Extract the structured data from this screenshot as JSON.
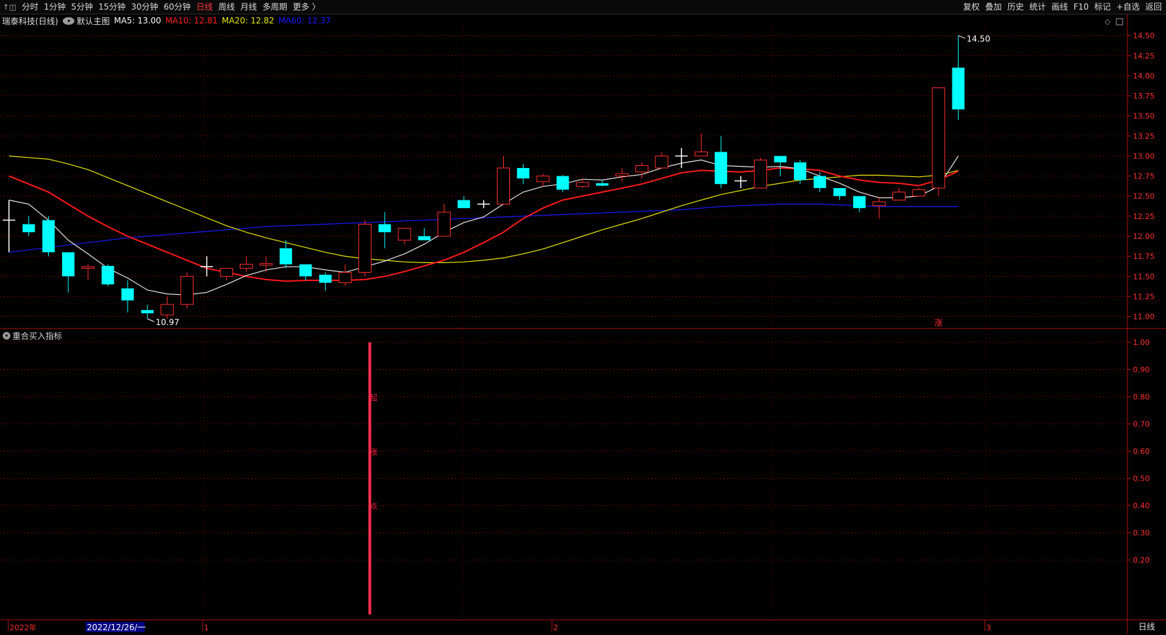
{
  "toolbar": {
    "left_glyph": "↑◫",
    "periods": [
      "分时",
      "1分钟",
      "5分钟",
      "15分钟",
      "30分钟",
      "60分钟",
      "日线",
      "周线",
      "月线",
      "多周期",
      "更多 〉"
    ],
    "active_period": "日线",
    "actions": [
      "复权",
      "叠加",
      "历史",
      "统计",
      "画线",
      "F10",
      "标记",
      "+自选",
      "返回"
    ]
  },
  "main_chart": {
    "stock_name": "瑞泰科技",
    "period_tag": "(日线)",
    "template": "默认主图",
    "ma5": {
      "label": "MA5: 13.00",
      "color": "#ffffff"
    },
    "ma10": {
      "label": "MA10: 12.81",
      "color": "#ff2020"
    },
    "ma20": {
      "label": "MA20: 12.82",
      "color": "#e8e800"
    },
    "ma60": {
      "label": "MA60: 12.37",
      "color": "#1a1aff"
    },
    "high_marker": "14.50",
    "low_marker": "10.97",
    "badge": "涨",
    "up_color": "#ff3030",
    "down_color": "#00ffff"
  },
  "indicator": {
    "title": "重合买入指标",
    "signal_text": [
      "起",
      "涨",
      "点"
    ],
    "signal_color": "#ff3050"
  },
  "x_axis": {
    "labels": [
      "2022年",
      "2022/12/26/一",
      "1",
      "2",
      "3"
    ],
    "mode": "日线"
  },
  "chart_data": [
    {
      "type": "candlestick",
      "title": "瑞泰科技 (日线)",
      "y_ticks": [
        "14.50",
        "14.25",
        "14.00",
        "13.75",
        "13.50",
        "13.25",
        "13.00",
        "12.75",
        "12.50",
        "12.25",
        "12.00",
        "11.75",
        "11.50",
        "11.25",
        "11.00"
      ],
      "ylim": [
        10.85,
        14.6
      ],
      "candles": [
        {
          "o": 12.2,
          "h": 12.45,
          "l": 11.8,
          "c": 12.2
        },
        {
          "o": 12.15,
          "h": 12.25,
          "l": 12.0,
          "c": 12.05
        },
        {
          "o": 12.2,
          "h": 12.25,
          "l": 11.75,
          "c": 11.8
        },
        {
          "o": 11.8,
          "h": 11.8,
          "l": 11.3,
          "c": 11.5
        },
        {
          "o": 11.6,
          "h": 11.65,
          "l": 11.45,
          "c": 11.62
        },
        {
          "o": 11.63,
          "h": 11.65,
          "l": 11.38,
          "c": 11.4
        },
        {
          "o": 11.35,
          "h": 11.45,
          "l": 11.05,
          "c": 11.2
        },
        {
          "o": 11.08,
          "h": 11.15,
          "l": 10.97,
          "c": 11.04
        },
        {
          "o": 11.02,
          "h": 11.25,
          "l": 10.97,
          "c": 11.15
        },
        {
          "o": 11.15,
          "h": 11.55,
          "l": 11.1,
          "c": 11.5
        },
        {
          "o": 11.62,
          "h": 11.75,
          "l": 11.5,
          "c": 11.62
        },
        {
          "o": 11.5,
          "h": 11.6,
          "l": 11.45,
          "c": 11.6
        },
        {
          "o": 11.6,
          "h": 11.75,
          "l": 11.55,
          "c": 11.65
        },
        {
          "o": 11.64,
          "h": 11.75,
          "l": 11.55,
          "c": 11.66
        },
        {
          "o": 11.85,
          "h": 11.95,
          "l": 11.6,
          "c": 11.65
        },
        {
          "o": 11.65,
          "h": 11.65,
          "l": 11.45,
          "c": 11.5
        },
        {
          "o": 11.52,
          "h": 11.55,
          "l": 11.32,
          "c": 11.42
        },
        {
          "o": 11.42,
          "h": 11.65,
          "l": 11.38,
          "c": 11.55
        },
        {
          "o": 11.55,
          "h": 12.2,
          "l": 11.5,
          "c": 12.15
        },
        {
          "o": 12.15,
          "h": 12.3,
          "l": 11.85,
          "c": 12.05
        },
        {
          "o": 11.95,
          "h": 12.1,
          "l": 11.9,
          "c": 12.1
        },
        {
          "o": 12.0,
          "h": 12.1,
          "l": 11.95,
          "c": 11.95
        },
        {
          "o": 12.0,
          "h": 12.4,
          "l": 12.0,
          "c": 12.3
        },
        {
          "o": 12.45,
          "h": 12.5,
          "l": 12.35,
          "c": 12.35
        },
        {
          "o": 12.4,
          "h": 12.45,
          "l": 12.35,
          "c": 12.4
        },
        {
          "o": 12.4,
          "h": 13.0,
          "l": 12.4,
          "c": 12.85
        },
        {
          "o": 12.85,
          "h": 12.9,
          "l": 12.65,
          "c": 12.72
        },
        {
          "o": 12.68,
          "h": 12.78,
          "l": 12.62,
          "c": 12.75
        },
        {
          "o": 12.75,
          "h": 12.76,
          "l": 12.55,
          "c": 12.58
        },
        {
          "o": 12.62,
          "h": 12.72,
          "l": 12.6,
          "c": 12.67
        },
        {
          "o": 12.66,
          "h": 12.7,
          "l": 12.62,
          "c": 12.63
        },
        {
          "o": 12.75,
          "h": 12.85,
          "l": 12.68,
          "c": 12.78
        },
        {
          "o": 12.8,
          "h": 12.92,
          "l": 12.72,
          "c": 12.88
        },
        {
          "o": 12.85,
          "h": 13.05,
          "l": 12.85,
          "c": 13.0
        },
        {
          "o": 13.0,
          "h": 13.1,
          "l": 12.85,
          "c": 13.0
        },
        {
          "o": 13.0,
          "h": 13.28,
          "l": 13.0,
          "c": 13.05
        },
        {
          "o": 13.05,
          "h": 13.25,
          "l": 12.6,
          "c": 12.65
        },
        {
          "o": 12.7,
          "h": 12.75,
          "l": 12.6,
          "c": 12.69
        },
        {
          "o": 12.6,
          "h": 12.98,
          "l": 12.6,
          "c": 12.95
        },
        {
          "o": 13.0,
          "h": 13.0,
          "l": 12.75,
          "c": 12.92
        },
        {
          "o": 12.92,
          "h": 12.95,
          "l": 12.65,
          "c": 12.7
        },
        {
          "o": 12.75,
          "h": 12.8,
          "l": 12.55,
          "c": 12.6
        },
        {
          "o": 12.6,
          "h": 12.6,
          "l": 12.45,
          "c": 12.5
        },
        {
          "o": 12.5,
          "h": 12.5,
          "l": 12.3,
          "c": 12.35
        },
        {
          "o": 12.38,
          "h": 12.48,
          "l": 12.22,
          "c": 12.43
        },
        {
          "o": 12.45,
          "h": 12.6,
          "l": 12.45,
          "c": 12.55
        },
        {
          "o": 12.5,
          "h": 12.6,
          "l": 12.5,
          "c": 12.58
        },
        {
          "o": 12.6,
          "h": 13.85,
          "l": 12.5,
          "c": 13.85
        },
        {
          "o": 14.1,
          "h": 14.5,
          "l": 13.45,
          "c": 13.58
        }
      ],
      "ma5": [
        12.45,
        12.4,
        12.2,
        11.95,
        11.78,
        11.6,
        11.48,
        11.33,
        11.28,
        11.27,
        11.3,
        11.4,
        11.51,
        11.58,
        11.62,
        11.62,
        11.58,
        11.55,
        11.62,
        11.69,
        11.78,
        11.9,
        12.05,
        12.17,
        12.24,
        12.4,
        12.55,
        12.62,
        12.65,
        12.71,
        12.7,
        12.74,
        12.77,
        12.85,
        12.91,
        12.95,
        12.88,
        12.87,
        12.86,
        12.87,
        12.84,
        12.75,
        12.66,
        12.55,
        12.48,
        12.48,
        12.5,
        12.62,
        13.0
      ],
      "ma10": [
        12.75,
        12.65,
        12.55,
        12.4,
        12.25,
        12.12,
        12.0,
        11.9,
        11.8,
        11.7,
        11.6,
        11.55,
        11.5,
        11.46,
        11.44,
        11.45,
        11.45,
        11.45,
        11.46,
        11.5,
        11.56,
        11.63,
        11.7,
        11.8,
        11.92,
        12.05,
        12.22,
        12.35,
        12.45,
        12.5,
        12.55,
        12.6,
        12.65,
        12.72,
        12.79,
        12.82,
        12.81,
        12.8,
        12.82,
        12.85,
        12.84,
        12.82,
        12.75,
        12.7,
        12.67,
        12.66,
        12.63,
        12.7,
        12.81
      ],
      "ma20": [
        13.0,
        12.98,
        12.96,
        12.9,
        12.83,
        12.73,
        12.63,
        12.53,
        12.43,
        12.33,
        12.23,
        12.13,
        12.05,
        11.98,
        11.92,
        11.86,
        11.8,
        11.75,
        11.72,
        11.7,
        11.68,
        11.67,
        11.67,
        11.68,
        11.7,
        11.73,
        11.78,
        11.84,
        11.92,
        12.0,
        12.08,
        12.15,
        12.22,
        12.3,
        12.38,
        12.45,
        12.52,
        12.57,
        12.62,
        12.66,
        12.7,
        12.72,
        12.74,
        12.76,
        12.76,
        12.75,
        12.74,
        12.76,
        12.82
      ],
      "ma60": [
        11.8,
        11.83,
        11.86,
        11.89,
        11.92,
        11.95,
        11.98,
        12.0,
        12.02,
        12.04,
        12.06,
        12.08,
        12.1,
        12.12,
        12.13,
        12.14,
        12.15,
        12.16,
        12.17,
        12.18,
        12.19,
        12.2,
        12.21,
        12.22,
        12.23,
        12.24,
        12.25,
        12.26,
        12.27,
        12.28,
        12.29,
        12.3,
        12.31,
        12.32,
        12.33,
        12.35,
        12.37,
        12.38,
        12.39,
        12.4,
        12.4,
        12.4,
        12.39,
        12.38,
        12.37,
        12.37,
        12.37,
        12.37,
        12.37
      ]
    },
    {
      "type": "bar",
      "title": "重合买入指标",
      "y_ticks": [
        "1.00",
        "0.90",
        "0.80",
        "0.70",
        "0.60",
        "0.50",
        "0.40",
        "0.30",
        "0.20"
      ],
      "ylim": [
        -0.02,
        1.0
      ],
      "signals": [
        {
          "index": 18,
          "value": 1.0
        }
      ]
    }
  ]
}
